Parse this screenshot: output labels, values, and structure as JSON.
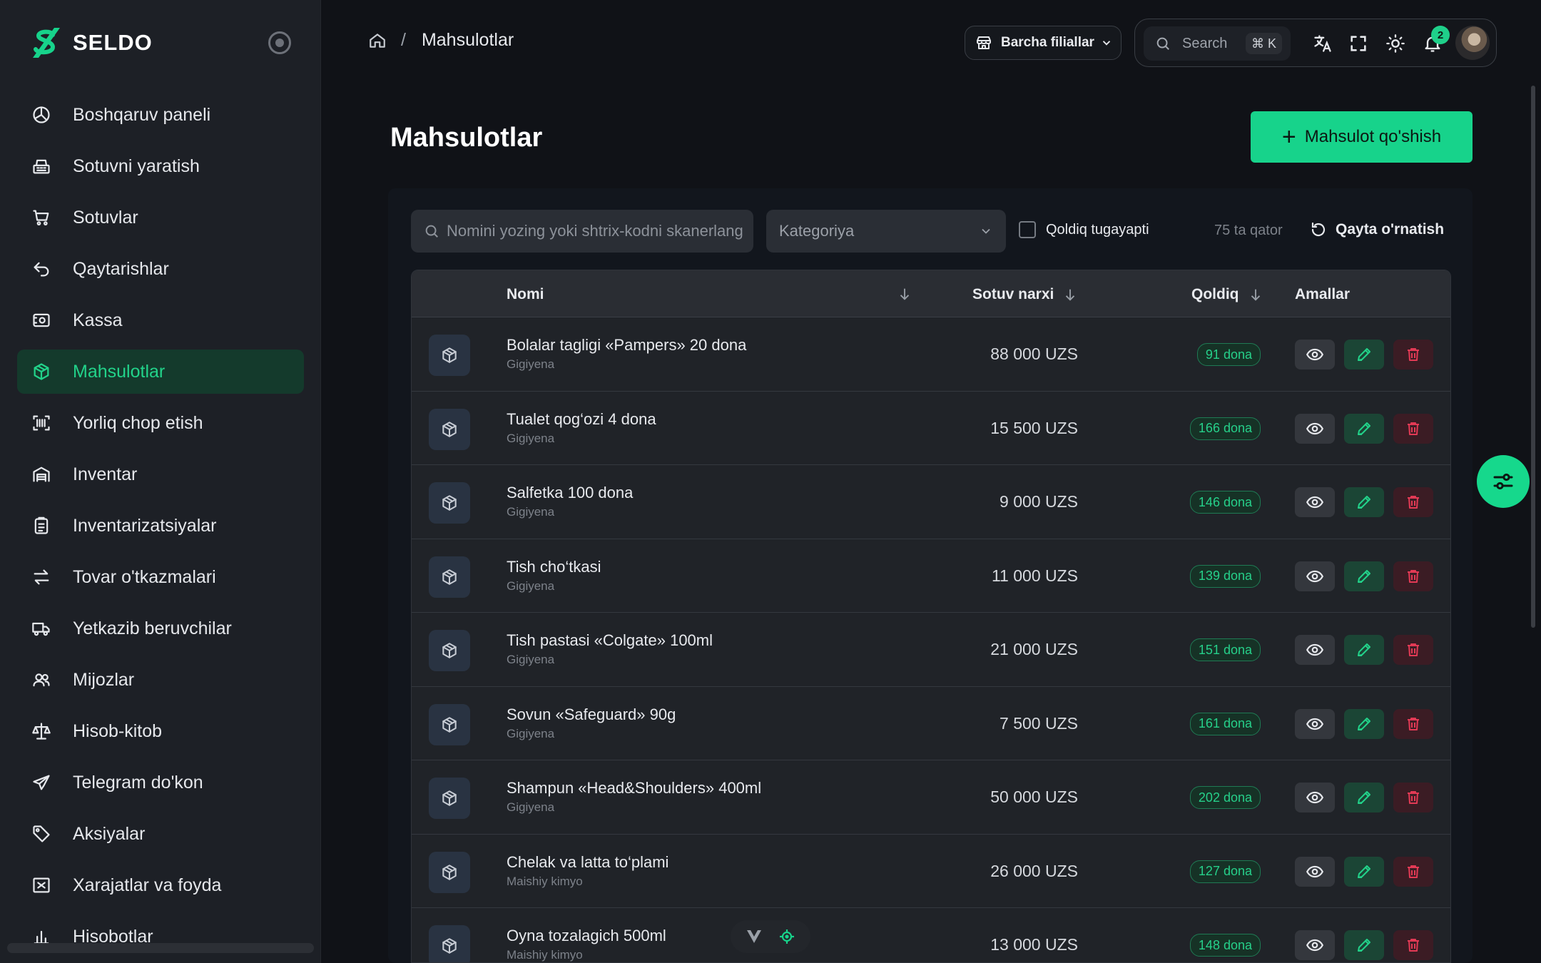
{
  "brand": {
    "name": "SELDO"
  },
  "sidebar": {
    "items": [
      {
        "label": "Boshqaruv paneli",
        "icon": "dashboard-icon",
        "active": false
      },
      {
        "label": "Sotuvni yaratish",
        "icon": "cash-register-icon",
        "active": false
      },
      {
        "label": "Sotuvlar",
        "icon": "cart-icon",
        "active": false
      },
      {
        "label": "Qaytarishlar",
        "icon": "return-icon",
        "active": false
      },
      {
        "label": "Kassa",
        "icon": "cash-box-icon",
        "active": false
      },
      {
        "label": "Mahsulotlar",
        "icon": "package-icon",
        "active": true
      },
      {
        "label": "Yorliq chop etish",
        "icon": "barcode-icon",
        "active": false
      },
      {
        "label": "Inventar",
        "icon": "warehouse-icon",
        "active": false
      },
      {
        "label": "Inventarizatsiyalar",
        "icon": "clipboard-icon",
        "active": false
      },
      {
        "label": "Tovar o'tkazmalari",
        "icon": "transfer-icon",
        "active": false
      },
      {
        "label": "Yetkazib beruvchilar",
        "icon": "truck-icon",
        "active": false
      },
      {
        "label": "Mijozlar",
        "icon": "users-icon",
        "active": false
      },
      {
        "label": "Hisob-kitob",
        "icon": "scale-icon",
        "active": false
      },
      {
        "label": "Telegram do'kon",
        "icon": "telegram-icon",
        "active": false
      },
      {
        "label": "Aksiyalar",
        "icon": "tag-icon",
        "active": false
      },
      {
        "label": "Xarajatlar va foyda",
        "icon": "expense-icon",
        "active": false
      },
      {
        "label": "Hisobotlar",
        "icon": "report-icon",
        "active": false
      }
    ]
  },
  "header": {
    "breadcrumb": "Mahsulotlar",
    "branch_select": "Barcha filiallar",
    "search_label": "Search",
    "shortcut": "⌘ K",
    "notification_count": "2"
  },
  "page": {
    "title": "Mahsulotlar",
    "add_button": "Mahsulot qo'shish"
  },
  "filters": {
    "search_placeholder": "Nomini yozing yoki shtrix-kodni skanerlang",
    "category_placeholder": "Kategoriya",
    "low_stock_label": "Qoldiq tugayapti",
    "rows_count": "75 ta qator",
    "reset_label": "Qayta o'rnatish"
  },
  "table": {
    "headers": {
      "name": "Nomi",
      "price": "Sotuv narxi",
      "stock": "Qoldiq",
      "actions": "Amallar"
    },
    "rows": [
      {
        "name": "Bolalar tagligi «Pampers» 20 dona",
        "category": "Gigiyena",
        "price": "88 000 UZS",
        "stock": "91 dona"
      },
      {
        "name": "Tualet qog‘ozi 4 dona",
        "category": "Gigiyena",
        "price": "15 500 UZS",
        "stock": "166 dona"
      },
      {
        "name": "Salfetka 100 dona",
        "category": "Gigiyena",
        "price": "9 000 UZS",
        "stock": "146 dona"
      },
      {
        "name": "Tish cho‘tkasi",
        "category": "Gigiyena",
        "price": "11 000 UZS",
        "stock": "139 dona"
      },
      {
        "name": "Tish pastasi «Colgate» 100ml",
        "category": "Gigiyena",
        "price": "21 000 UZS",
        "stock": "151 dona"
      },
      {
        "name": "Sovun «Safeguard» 90g",
        "category": "Gigiyena",
        "price": "7 500 UZS",
        "stock": "161 dona"
      },
      {
        "name": "Shampun «Head&Shoulders» 400ml",
        "category": "Gigiyena",
        "price": "50 000 UZS",
        "stock": "202 dona"
      },
      {
        "name": "Chelak va latta to‘plami",
        "category": "Maishiy kimyo",
        "price": "26 000 UZS",
        "stock": "127 dona"
      },
      {
        "name": "Oyna tozalagich 500ml",
        "category": "Maishiy kimyo",
        "price": "13 000 UZS",
        "stock": "148 dona"
      }
    ]
  },
  "colors": {
    "accent": "#17d38b",
    "sidebar_bg": "#1d2026",
    "page_bg": "#101217",
    "danger": "#e23a55"
  }
}
